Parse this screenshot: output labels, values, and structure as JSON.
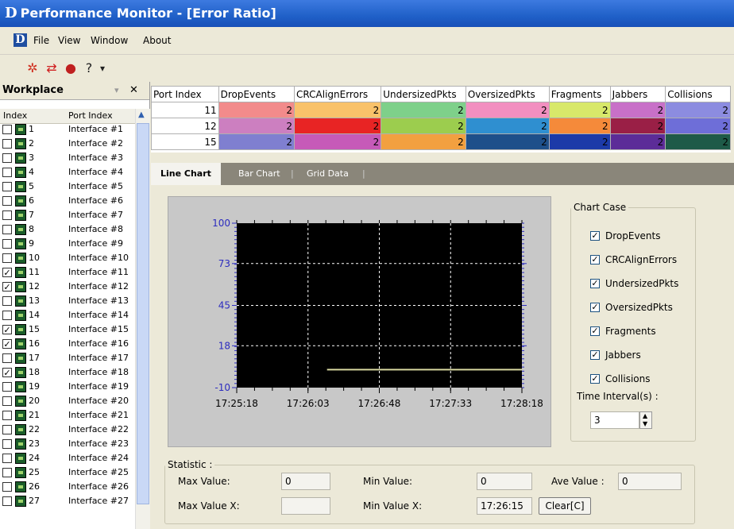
{
  "window": {
    "title": "Performance Monitor - [Error Ratio]"
  },
  "menu": {
    "items": [
      "File",
      "View",
      "Window",
      "About"
    ]
  },
  "workplace": {
    "title": "Workplace",
    "columns": [
      "Index",
      "Port Index"
    ],
    "rows": [
      {
        "index": "1",
        "name": "Interface #1",
        "checked": false
      },
      {
        "index": "2",
        "name": "Interface #2",
        "checked": false
      },
      {
        "index": "3",
        "name": "Interface #3",
        "checked": false
      },
      {
        "index": "4",
        "name": "Interface #4",
        "checked": false
      },
      {
        "index": "5",
        "name": "Interface #5",
        "checked": false
      },
      {
        "index": "6",
        "name": "Interface #6",
        "checked": false
      },
      {
        "index": "7",
        "name": "Interface #7",
        "checked": false
      },
      {
        "index": "8",
        "name": "Interface #8",
        "checked": false
      },
      {
        "index": "9",
        "name": "Interface #9",
        "checked": false
      },
      {
        "index": "10",
        "name": "Interface #10",
        "checked": false
      },
      {
        "index": "11",
        "name": "Interface #11",
        "checked": true
      },
      {
        "index": "12",
        "name": "Interface #12",
        "checked": true
      },
      {
        "index": "13",
        "name": "Interface #13",
        "checked": false
      },
      {
        "index": "14",
        "name": "Interface #14",
        "checked": false
      },
      {
        "index": "15",
        "name": "Interface #15",
        "checked": true
      },
      {
        "index": "16",
        "name": "Interface #16",
        "checked": true
      },
      {
        "index": "17",
        "name": "Interface #17",
        "checked": false
      },
      {
        "index": "18",
        "name": "Interface #18",
        "checked": true
      },
      {
        "index": "19",
        "name": "Interface #19",
        "checked": false
      },
      {
        "index": "20",
        "name": "Interface #20",
        "checked": false
      },
      {
        "index": "21",
        "name": "Interface #21",
        "checked": false
      },
      {
        "index": "22",
        "name": "Interface #22",
        "checked": false
      },
      {
        "index": "23",
        "name": "Interface #23",
        "checked": false
      },
      {
        "index": "24",
        "name": "Interface #24",
        "checked": false
      },
      {
        "index": "25",
        "name": "Interface #25",
        "checked": false
      },
      {
        "index": "26",
        "name": "Interface #26",
        "checked": false
      },
      {
        "index": "27",
        "name": "Interface #27",
        "checked": false
      }
    ]
  },
  "grid": {
    "columns": [
      "Port Index",
      "DropEvents",
      "CRCAlignErrors",
      "UndersizedPkts",
      "OversizedPkts",
      "Fragments",
      "Jabbers",
      "Collisions"
    ],
    "rows": [
      {
        "cells": [
          "11",
          "2",
          "2",
          "2",
          "2",
          "2",
          "2",
          "2"
        ],
        "colors": [
          "#ffffff",
          "#f28b8b",
          "#f9c26a",
          "#7ed08a",
          "#f28fc0",
          "#d8e86a",
          "#c870c8",
          "#8c8ce0"
        ]
      },
      {
        "cells": [
          "12",
          "2",
          "2",
          "2",
          "2",
          "2",
          "2",
          "2"
        ],
        "colors": [
          "#ffffff",
          "#cc7fc0",
          "#e82424",
          "#9ccd4e",
          "#2f8fd0",
          "#f58a3a",
          "#9a1f46",
          "#6e6ed8"
        ]
      },
      {
        "cells": [
          "15",
          "2",
          "2",
          "2",
          "2",
          "2",
          "2",
          "2"
        ],
        "colors": [
          "#ffffff",
          "#7f7fd0",
          "#c65ab8",
          "#f2a040",
          "#1e4f8a",
          "#1c3aa8",
          "#5c2c98",
          "#1e5a48"
        ]
      }
    ]
  },
  "tabs": [
    "Line Chart",
    "Bar Chart",
    "Grid Data"
  ],
  "chart_data": {
    "type": "line",
    "title": "",
    "y_ticks": [
      "100",
      "73",
      "45",
      "18",
      "-10"
    ],
    "x_ticks": [
      "17:25:18",
      "17:26:03",
      "17:26:48",
      "17:27:33",
      "17:28:18"
    ],
    "ylim": [
      -10,
      100
    ],
    "grid": true,
    "series": [
      {
        "color": "#d8d8a0",
        "x": [
          "17:26:15",
          "17:28:18"
        ],
        "values": [
          2,
          2
        ]
      }
    ]
  },
  "chart_case": {
    "title": "Chart Case",
    "items": [
      "DropEvents",
      "CRCAlignErrors",
      "UndersizedPkts",
      "OversizedPkts",
      "Fragments",
      "Jabbers",
      "Collisions"
    ],
    "time_interval_label": "Time Interval(s) :",
    "time_interval_value": "3"
  },
  "statistic": {
    "title": "Statistic :",
    "max_value_label": "Max Value:",
    "max_value": "0",
    "min_value_label": "Min Value:",
    "min_value": "0",
    "ave_value_label": "Ave Value :",
    "ave_value": "0",
    "max_value_x_label": "Max Value X:",
    "max_value_x": "",
    "min_value_x_label": "Min Value X:",
    "min_value_x": "17:26:15",
    "clear_label": "Clear[C]"
  }
}
